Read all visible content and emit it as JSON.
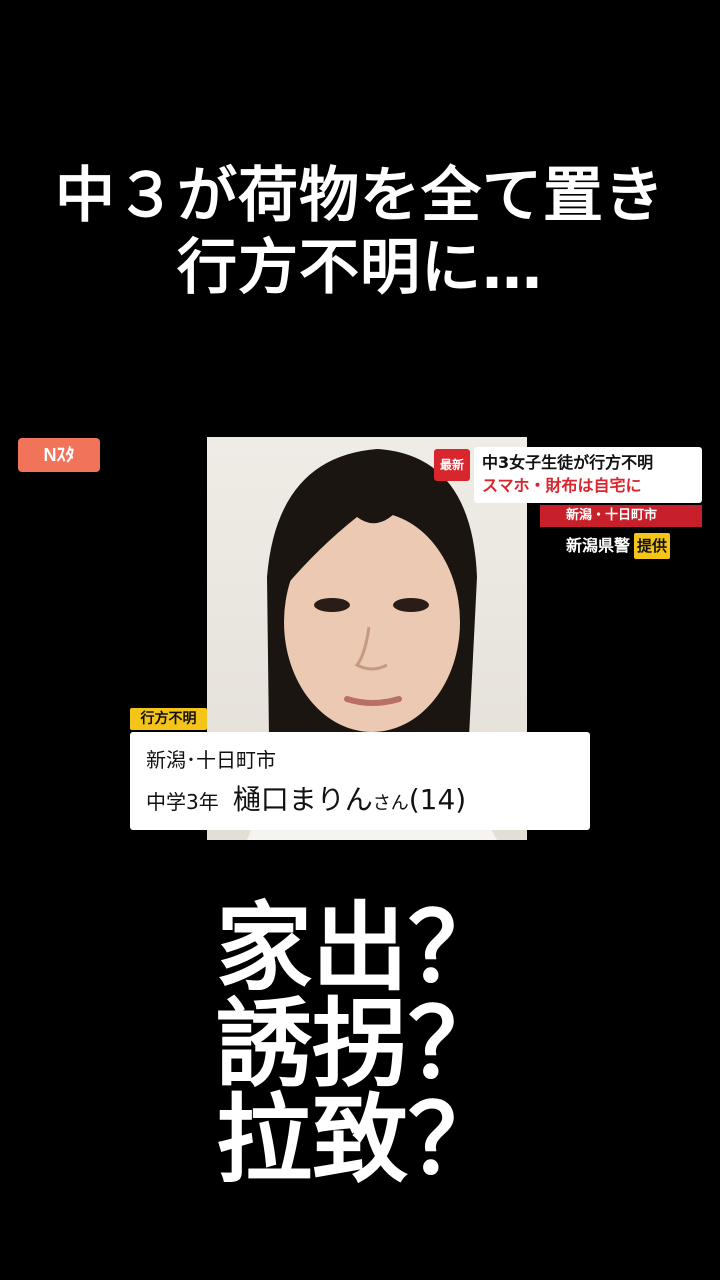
{
  "headline": {
    "line1": "中３が荷物を全て置き",
    "line2": "行方不明に…"
  },
  "news_overlay": {
    "logo": "Nｽﾀ",
    "latest_tag": "最新",
    "ticker_line1": "中3女子生徒が行方不明",
    "ticker_line2": "スマホ・財布は自宅に",
    "ticker_location": "新潟・十日町市",
    "photo_source": "新潟県警",
    "photo_provided": "提供",
    "status_tag": "行方不明",
    "card_location": "新潟･十日町市",
    "card_grade": "中学3年",
    "card_name": "樋口まりん",
    "card_honorific": "さん",
    "card_age": "(14)"
  },
  "questions": [
    "家出？",
    "誘拐？",
    "拉致？"
  ],
  "colors": {
    "background": "#000000",
    "logo": "#f0735a",
    "accent_red": "#d9262e",
    "tag_yellow": "#f4c518"
  }
}
